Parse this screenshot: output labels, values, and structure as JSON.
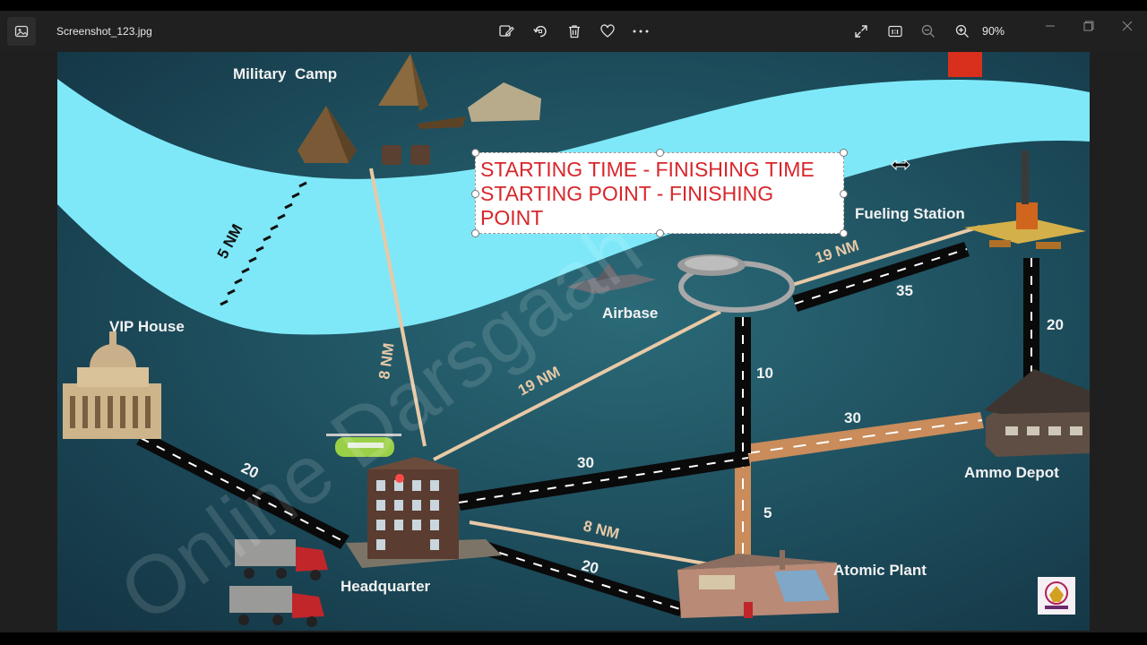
{
  "titlebar": {
    "file_name": "Screenshot_123.jpg",
    "zoom_level": "90%",
    "icons": {
      "app": "photo-app-icon",
      "edit": "edit-image-icon",
      "rotate": "rotate-icon",
      "delete": "trash-icon",
      "favorite": "heart-icon",
      "more": "more-icon",
      "fullscreen": "fullscreen-icon",
      "actual_size": "actual-size-icon",
      "zoom_out": "zoom-out-icon",
      "zoom_in": "zoom-in-icon",
      "minimize": "minimize-icon",
      "maximize": "maximize-icon",
      "close": "close-icon"
    }
  },
  "map": {
    "locations": {
      "military_camp": "Military  Camp",
      "vip_house": "VIP House",
      "airbase": "Airbase",
      "fueling_station": "Fueling Station",
      "ammo_depot": "Ammo Depot",
      "headquarter": "Headquarter",
      "atomic_plant": "Atomic Plant"
    },
    "distances": {
      "river_width": "5 NM",
      "camp_to_hq": "8 NM",
      "hq_to_airbase": "19 NM",
      "airbase_to_fuel": "19 NM",
      "airbase_fuel_road": "35",
      "fuel_to_ammo": "20",
      "airbase_down": "10",
      "junction_to_ammo": "30",
      "hq_to_junction": "30",
      "vip_to_hq": "20",
      "junction_to_atomic": "5",
      "hq_to_atomic_air": "8 NM",
      "hq_to_atomic_road": "20"
    },
    "watermark": "Online Darsgaah",
    "colors": {
      "background": "#1f4a58",
      "river": "#7ee8f8",
      "road": "#0a0a0a",
      "dirt_road": "#c98c5a",
      "air_route": "#e8c9a6"
    }
  },
  "annotation": {
    "line1": "STARTING TIME - FINISHING TIME",
    "line2": "STARTING POINT - FINISHING",
    "line3": "POINT",
    "color": "#d8262b"
  },
  "cursor": "resize-horizontal-cursor"
}
